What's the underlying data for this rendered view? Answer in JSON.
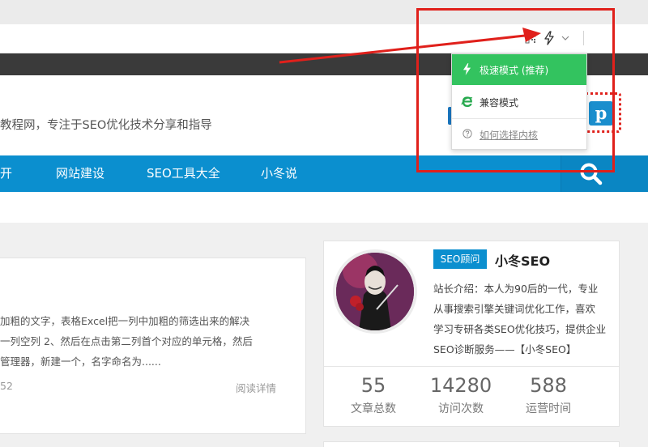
{
  "browser": {
    "icons": [
      "qr-code-icon",
      "lightning-icon",
      "chevron-down-icon"
    ],
    "menu": {
      "items": [
        {
          "label": "极速模式 (推荐)",
          "icon": "lightning-icon",
          "selected": true
        },
        {
          "label": "兼容模式",
          "icon": "ie-icon",
          "selected": false
        },
        {
          "label": "如何选择内核",
          "icon": "question-icon",
          "selected": false
        }
      ]
    }
  },
  "site": {
    "description": "教程网，专注于SEO优化技术分享和指导",
    "social_icon": "pinterest-icon"
  },
  "nav": {
    "items": [
      "开",
      "网站建设",
      "SEO工具大全",
      "小冬说"
    ],
    "search_icon": "search-icon"
  },
  "article": {
    "lines": [
      "加粗的文字，表格Excel把一列中加粗的筛选出来的解决",
      "一列空列 2、然后在点击第二列首个对应的单元格，然后",
      "管理器，新建一个，名字命名为......"
    ],
    "date": "52",
    "read_more": "阅读详情"
  },
  "profile": {
    "badge": "SEO顾问",
    "name": "小冬SEO",
    "bio": [
      "站长介绍：本人为90后的一代，专业",
      "从事搜索引擎关键词优化工作，喜欢",
      "学习专研各类SEO优化技巧，提供企业",
      "SEO诊断服务——【小冬SEO】"
    ],
    "stats": [
      {
        "value": "55",
        "label": "文章总数"
      },
      {
        "value": "14280",
        "label": "访问次数"
      },
      {
        "value": "588",
        "label": "运营时间"
      }
    ]
  },
  "colors": {
    "nav_blue": "#0b8fcf",
    "menu_green": "#33c35f",
    "annotation_red": "#e0201b"
  }
}
